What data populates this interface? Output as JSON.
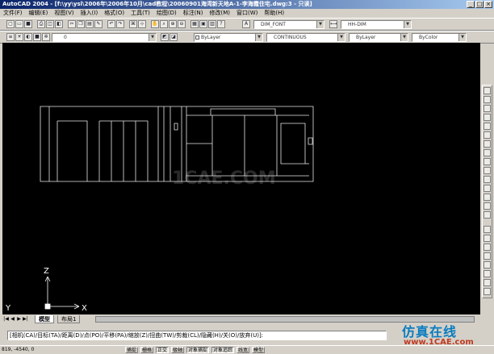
{
  "window": {
    "title": "AutoCAD 2004 - [f:\\yy\\ysl\\2006年\\2006年10月\\cad教程\\20060901海湾新天地A-1-李海霞住宅.dwg:3 - 只读]",
    "controls": [
      "_",
      "□",
      "×"
    ]
  },
  "menu": [
    "文件(F)",
    "编辑(E)",
    "视图(V)",
    "插入(I)",
    "格式(O)",
    "工具(T)",
    "绘图(D)",
    "标注(N)",
    "修改(M)",
    "窗口(W)",
    "帮助(H)"
  ],
  "toolbar1": {
    "text_style": "DIM_FONT",
    "dim_style": "HH-DIM"
  },
  "toolbar2": {
    "layer": "0",
    "color": "ByLayer",
    "linetype": "CONTINUOUS",
    "lineweight": "ByLayer",
    "plotstyle": "ByColor"
  },
  "canvas": {
    "background": "#000000",
    "line_color": "#ffffff",
    "ucs_y": "Y",
    "ucs_z": "Z",
    "ucs_x": "X"
  },
  "tabs": [
    "模型",
    "布局1"
  ],
  "tab_nav": [
    "|◀",
    "◀",
    "▶",
    "▶|"
  ],
  "command_line": "[相机(CA)/目标(TA)/距离(D)/点(PO)/平移(PA)/缩放(Z)/扭曲(TW)/剪裁(CL)/隐藏(H)/关(O)/放弃(U)]:",
  "status": {
    "coords": "819, -4540, 0",
    "buttons": [
      "捕捉",
      "栅格",
      "正交",
      "极轴",
      "对象捕捉",
      "对象追踪",
      "线宽",
      "模型"
    ]
  },
  "watermark": {
    "chinese": "仿真在线",
    "url": "www.1CAE.com",
    "canvas_mark": "1CAE.COM"
  }
}
